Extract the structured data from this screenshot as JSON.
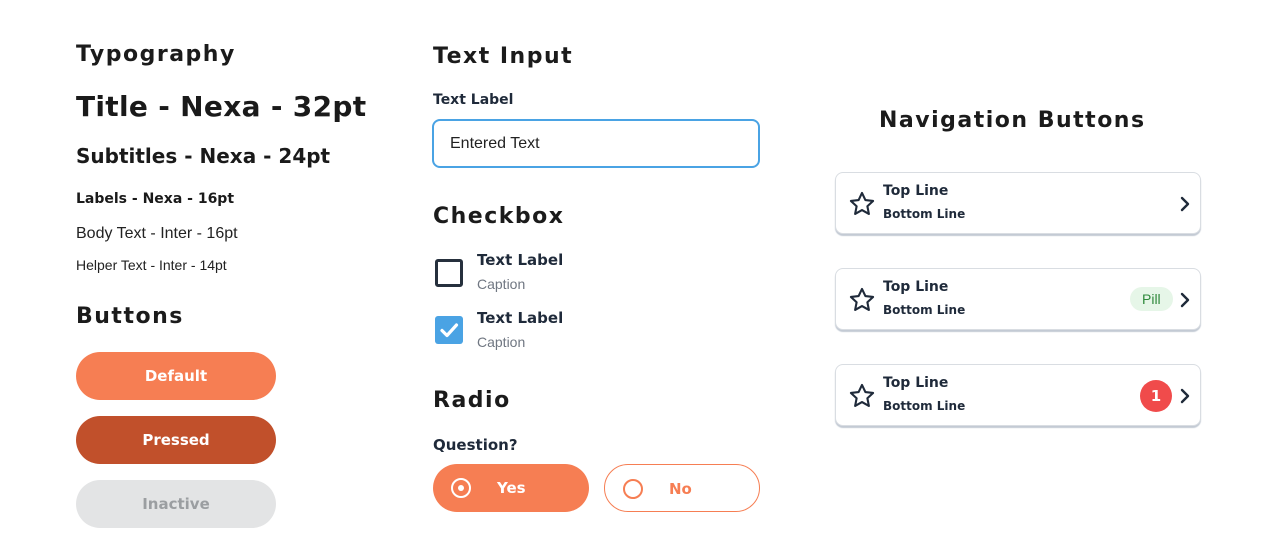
{
  "typography": {
    "heading": "Typography",
    "title_sample": "Title - Nexa - 32pt",
    "subtitle_sample": "Subtitles - Nexa - 24pt",
    "label_sample": "Labels - Nexa - 16pt",
    "body_sample": "Body Text - Inter - 16pt",
    "helper_sample": "Helper Text - Inter - 14pt"
  },
  "buttons": {
    "heading": "Buttons",
    "default_label": "Default",
    "pressed_label": "Pressed",
    "inactive_label": "Inactive"
  },
  "text_input": {
    "heading": "Text Input",
    "label": "Text Label",
    "value": "Entered Text"
  },
  "checkbox": {
    "heading": "Checkbox",
    "items": [
      {
        "label": "Text Label",
        "caption": "Caption",
        "checked": false
      },
      {
        "label": "Text Label",
        "caption": "Caption",
        "checked": true
      }
    ]
  },
  "radio": {
    "heading": "Radio",
    "question": "Question?",
    "options": [
      {
        "label": "Yes",
        "selected": true
      },
      {
        "label": "No",
        "selected": false
      }
    ]
  },
  "navigation": {
    "heading": "Navigation Buttons",
    "items": [
      {
        "top_line": "Top Line",
        "bottom_line": "Bottom Line",
        "icon": "star-icon"
      },
      {
        "top_line": "Top Line",
        "bottom_line": "Bottom Line",
        "icon": "star-icon",
        "pill": "Pill"
      },
      {
        "top_line": "Top Line",
        "bottom_line": "Bottom Line",
        "icon": "star-icon",
        "badge": "1"
      }
    ]
  },
  "colors": {
    "primary": "#f67e53",
    "primary_pressed": "#c1502b",
    "inactive": "#e3e4e5",
    "focus_blue": "#4aa3e4",
    "badge_red": "#f04b4b",
    "pill_bg": "#e6f6e8",
    "pill_text": "#2f8a3c"
  }
}
